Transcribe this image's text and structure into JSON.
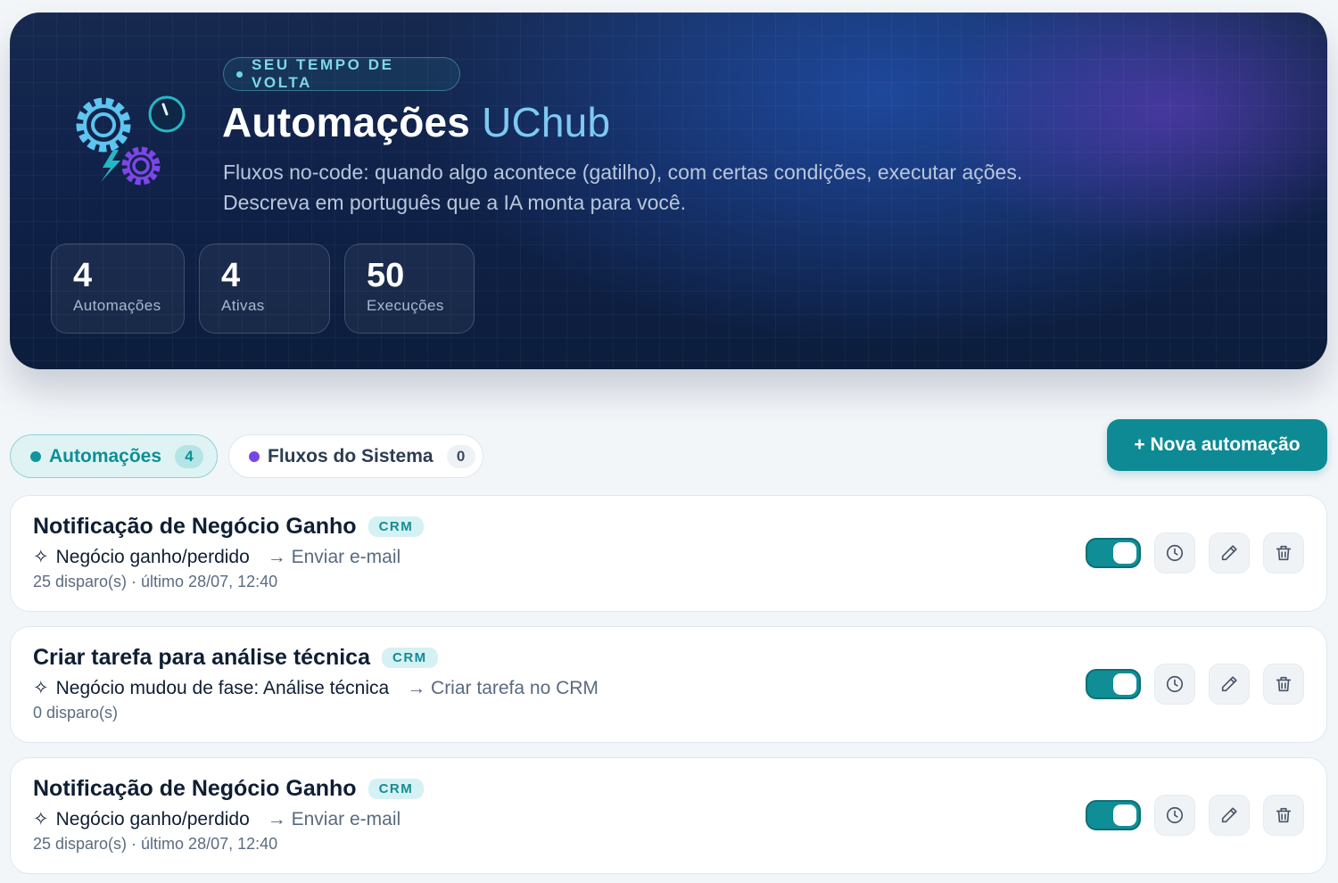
{
  "hero": {
    "pill": "SEU TEMPO DE VOLTA",
    "title_main": "Automações",
    "title_brand": "UChub",
    "desc_line1": "Fluxos no-code: quando algo acontece (gatilho), com certas condições, executar ações.",
    "desc_line2": "Descreva em português que a IA monta para você.",
    "stats": [
      {
        "value": "4",
        "label": "Automações"
      },
      {
        "value": "4",
        "label": "Ativas"
      },
      {
        "value": "50",
        "label": "Execuções"
      }
    ]
  },
  "tabs": [
    {
      "label": "Automações",
      "count": "4",
      "active": true
    },
    {
      "label": "Fluxos do Sistema",
      "count": "0",
      "active": false
    }
  ],
  "new_button": "+ Nova automação",
  "automations": [
    {
      "title": "Notificação de Negócio Ganho",
      "badge": "CRM",
      "trigger": "Negócio ganho/perdido",
      "action": "→ Enviar e-mail",
      "meta": "25 disparo(s) · último 28/07, 12:40",
      "enabled": true
    },
    {
      "title": "Criar tarefa para análise técnica",
      "badge": "CRM",
      "trigger": "Negócio mudou de fase: Análise técnica",
      "action": "→ Criar tarefa no CRM",
      "meta": "0 disparo(s)",
      "enabled": true
    },
    {
      "title": "Notificação de Negócio Ganho",
      "badge": "CRM",
      "trigger": "Negócio ganho/perdido",
      "action": "→ Enviar e-mail",
      "meta": "25 disparo(s) · último 28/07, 12:40",
      "enabled": true
    }
  ],
  "icons": {
    "trigger": "sparkle-icon",
    "history": "clock-icon",
    "edit": "pencil-icon",
    "delete": "trash-icon"
  },
  "colors": {
    "accent": "#0e8a94",
    "brand_title": "#7ec9f2",
    "tab_system_dot": "#7a45e6",
    "hero_bg": "#10224a"
  }
}
